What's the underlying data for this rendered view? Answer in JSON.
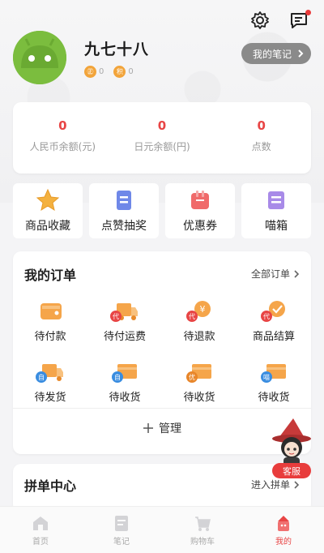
{
  "header": {
    "username": "九七十八",
    "badge_1_icon": "㊣",
    "badge_1_value": "0",
    "badge_2_icon": "积",
    "badge_2_value": "0",
    "notes_button": "我的笔记",
    "settings_icon": "gear-icon",
    "message_icon": "message-icon"
  },
  "balances": [
    {
      "value": "0",
      "label": "人民币余额(元)"
    },
    {
      "value": "0",
      "label": "日元余额(円)"
    },
    {
      "value": "0",
      "label": "点数"
    }
  ],
  "quick_actions": [
    {
      "label": "商品收藏",
      "icon": "star-icon"
    },
    {
      "label": "点赞抽奖",
      "icon": "lottery-icon"
    },
    {
      "label": "优惠券",
      "icon": "coupon-icon"
    },
    {
      "label": "喵箱",
      "icon": "box-icon"
    }
  ],
  "orders": {
    "title": "我的订单",
    "all_link": "全部订单",
    "items": [
      {
        "label": "待付款",
        "badge": ""
      },
      {
        "label": "待付运费",
        "badge": "代"
      },
      {
        "label": "待退款",
        "badge": "代"
      },
      {
        "label": "商品结算",
        "badge": "代"
      },
      {
        "label": "待发货",
        "badge": "自"
      },
      {
        "label": "待收货",
        "badge": "自"
      },
      {
        "label": "待收货",
        "badge": "优"
      },
      {
        "label": "待收货",
        "badge": "喵"
      }
    ],
    "manage_label": "管理"
  },
  "group": {
    "title": "拼单中心",
    "enter_link": "进入拼单"
  },
  "support": {
    "label": "客服"
  },
  "nav": [
    {
      "label": "首页"
    },
    {
      "label": "笔记"
    },
    {
      "label": "购物车"
    },
    {
      "label": "我的"
    }
  ],
  "colors": {
    "accent": "#e84545",
    "orange": "#f2a43a",
    "avatar": "#7bbd3e"
  }
}
